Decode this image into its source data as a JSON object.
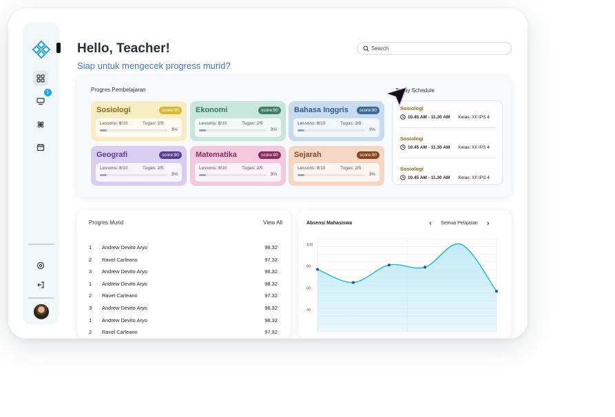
{
  "header": {
    "greeting": "Hello, Teacher!",
    "subtitle": "Siap untuk mengecek progress murid?",
    "search_placeholder": "Search"
  },
  "sidebar": {
    "notification_count": "1",
    "items": [
      {
        "icon": "grid-icon",
        "active": true
      },
      {
        "icon": "monitor-icon",
        "active": false
      },
      {
        "icon": "atom-icon",
        "active": false
      },
      {
        "icon": "calendar-icon",
        "active": false
      }
    ],
    "bottom_items": [
      {
        "icon": "settings-icon"
      },
      {
        "icon": "logout-icon"
      }
    ]
  },
  "learning": {
    "title": "Progres Pembelajaran",
    "courses": [
      {
        "name": "Sosiologi",
        "score": "score:90",
        "lessons": "Lessons: 8/10",
        "tugas": "Tugas: 2/5",
        "percent": "3%",
        "progress": 0.1,
        "bg": "#f7ecc2",
        "text_color": "#8b6a12",
        "badge": "#d9b92d"
      },
      {
        "name": "Ekonomi",
        "score": "score:90",
        "lessons": "Lessons: 8/10",
        "tugas": "Tugas: 2/5",
        "percent": "3%",
        "progress": 0.1,
        "bg": "#c9e6dc",
        "text_color": "#2f7a5f",
        "badge": "#3f7f67"
      },
      {
        "name": "Bahasa Inggris",
        "score": "score:90",
        "lessons": "Lessons: 8/10",
        "tugas": "Tugas: 2/5",
        "percent": "3%",
        "progress": 0.1,
        "bg": "#c8dcef",
        "text_color": "#2d5b8a",
        "badge": "#3f6a94"
      },
      {
        "name": "Geografi",
        "score": "score:90",
        "lessons": "Lessons: 8/10",
        "tugas": "Tugas: 2/5",
        "percent": "3%",
        "progress": 0.1,
        "bg": "#d9cdf0",
        "text_color": "#5a3c98",
        "badge": "#5a3f95"
      },
      {
        "name": "Matematika",
        "score": "score:90",
        "lessons": "Lessons: 8/10",
        "tugas": "Tugas: 2/5",
        "percent": "3%",
        "progress": 0.1,
        "bg": "#f3c9df",
        "text_color": "#8a2c5e",
        "badge": "#8a2c5e"
      },
      {
        "name": "Sejarah",
        "score": "score:90",
        "lessons": "Lessons: 8/10",
        "tugas": "Tugas: 2/5",
        "percent": "3%",
        "progress": 0.1,
        "bg": "#f6d6c4",
        "text_color": "#8a4a22",
        "badge": "#8a4420"
      }
    ]
  },
  "schedule": {
    "title": "Today Schedule",
    "items": [
      {
        "subject": "Sosiologi",
        "time": "10.45 AM - 11.30 AM",
        "kelas": "Kelas: XII IPS 4"
      },
      {
        "subject": "Sosiologi",
        "time": "10.45 AM - 11.30 AM",
        "kelas": "Kelas: XII IPS 4"
      },
      {
        "subject": "Sosiologi",
        "time": "10.45 AM - 11.30 AM",
        "kelas": "Kelas: XII IPS 4"
      }
    ]
  },
  "students": {
    "title": "Progres Murid",
    "view_all": "View All",
    "rows": [
      {
        "rank": "1",
        "name": "Andrew Devito Aryo",
        "score": "98.32"
      },
      {
        "rank": "2",
        "name": "Ravel Carleano",
        "score": "97.32"
      },
      {
        "rank": "3",
        "name": "Andrew Devito Aryo",
        "score": "96.32"
      },
      {
        "rank": "1",
        "name": "Andrew Devito Aryo",
        "score": "98.32"
      },
      {
        "rank": "2",
        "name": "Ravel Carleano",
        "score": "97.32"
      },
      {
        "rank": "3",
        "name": "Andrew Devito Aryo",
        "score": "96.32"
      },
      {
        "rank": "1",
        "name": "Andrew Devito Aryo",
        "score": "98.32"
      },
      {
        "rank": "2",
        "name": "Ravel Carleano",
        "score": "97.32"
      }
    ]
  },
  "attendance": {
    "title": "Absensi Mahasiswa",
    "filter_label": "Semua Pelajaran",
    "chart_data": {
      "type": "area",
      "x": [
        0,
        1,
        2,
        3,
        4,
        5
      ],
      "values": [
        77,
        65,
        81,
        79,
        100,
        57
      ],
      "yticks": [
        100,
        80,
        60,
        40
      ],
      "ylim": [
        20,
        105
      ],
      "grid": true,
      "line_color": "#1ab6d8",
      "fill_color": "#bfe9f4"
    }
  }
}
